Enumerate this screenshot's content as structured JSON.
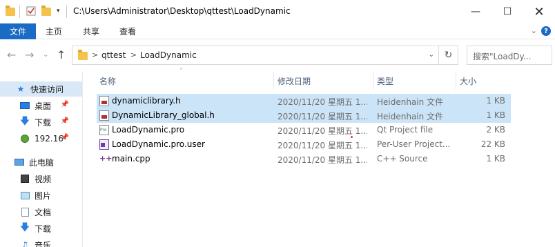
{
  "window": {
    "title": "C:\\Users\\Administrator\\Desktop\\qttest\\LoadDynamic",
    "minimize_icon": "minimize-icon",
    "maximize_icon": "maximize-icon",
    "close_icon": "close-icon"
  },
  "quick_access_toolbar": {
    "icons": [
      "folder-icon",
      "properties-check-icon",
      "new-folder-icon",
      "customize-dropdown-icon"
    ]
  },
  "ribbon": {
    "tabs": [
      "文件",
      "主页",
      "共享",
      "查看"
    ],
    "active_tab_color": "#1a6bc4",
    "help_label": "?"
  },
  "address_bar": {
    "breadcrumbs": [
      "qttest",
      "LoadDynamic"
    ],
    "refresh_icon": "refresh-icon"
  },
  "search": {
    "placeholder": "搜索\"LoadDy..."
  },
  "nav_pane": {
    "items": [
      {
        "label": "快速访问",
        "icon": "star-icon",
        "selected": true,
        "pinned": false
      },
      {
        "label": "桌面",
        "icon": "desktop-icon",
        "selected": false,
        "pinned": true
      },
      {
        "label": "下载",
        "icon": "download-icon",
        "selected": false,
        "pinned": true
      },
      {
        "label": "192.16",
        "icon": "network-share-icon",
        "selected": false,
        "pinned": true
      },
      {
        "label": "此电脑",
        "icon": "computer-icon",
        "selected": false,
        "pinned": false
      },
      {
        "label": "视频",
        "icon": "video-icon",
        "selected": false,
        "pinned": false
      },
      {
        "label": "图片",
        "icon": "pictures-icon",
        "selected": false,
        "pinned": false
      },
      {
        "label": "文档",
        "icon": "documents-icon",
        "selected": false,
        "pinned": false
      },
      {
        "label": "下载",
        "icon": "download-icon",
        "selected": false,
        "pinned": false
      },
      {
        "label": "音乐",
        "icon": "music-icon",
        "selected": false,
        "pinned": false
      }
    ]
  },
  "file_list": {
    "columns": [
      "名称",
      "修改日期",
      "类型",
      "大小"
    ],
    "rows": [
      {
        "name": "dynamiclibrary.h",
        "date": "2020/11/20 星期五 1...",
        "type": "Heidenhain 文件",
        "size": "1 KB",
        "icon": "header-file-icon",
        "selected": true
      },
      {
        "name": "DynamicLibrary_global.h",
        "date": "2020/11/20 星期五 1...",
        "type": "Heidenhain 文件",
        "size": "1 KB",
        "icon": "header-file-icon",
        "selected": true
      },
      {
        "name": "LoadDynamic.pro",
        "date": "2020/11/20 星期五 1...",
        "type": "Qt Project file",
        "size": "2 KB",
        "icon": "qt-project-icon",
        "selected": false
      },
      {
        "name": "LoadDynamic.pro.user",
        "date": "2020/11/20 星期五 1...",
        "type": "Per-User Project...",
        "size": "22 KB",
        "icon": "user-project-icon",
        "selected": false
      },
      {
        "name": "main.cpp",
        "date": "2020/11/20 星期五 1...",
        "type": "C++ Source",
        "size": "1 KB",
        "icon": "cpp-file-icon",
        "selected": false
      }
    ]
  }
}
